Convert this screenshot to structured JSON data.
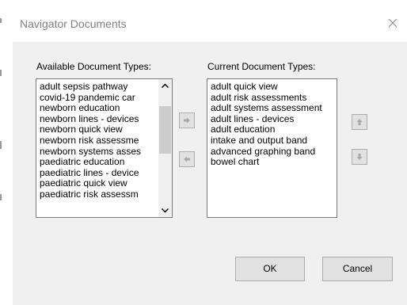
{
  "dialog": {
    "title": "Navigator Documents",
    "close_icon": "close-icon"
  },
  "available": {
    "label": "Available Document Types:",
    "items": [
      "adult sepsis pathway",
      "covid-19 pandemic car",
      "newborn education",
      "newborn lines - devices",
      "newborn quick view",
      "newborn risk assessme",
      "newborn systems asses",
      "paediatric education",
      "paediatric lines - device",
      "paediatric quick view",
      "paediatric risk assessm"
    ]
  },
  "current": {
    "label": "Current Document Types:",
    "items": [
      "adult quick view",
      "adult risk assessments",
      "adult systems assessment",
      "adult lines - devices",
      "adult education",
      "intake and output band",
      "advanced graphing band",
      "bowel chart"
    ]
  },
  "icons": {
    "add": "arrow-right-icon",
    "remove": "arrow-left-icon",
    "move_up": "arrow-up-icon",
    "move_down": "arrow-down-icon",
    "scroll_up": "scroll-up-icon",
    "scroll_down": "scroll-down-icon"
  },
  "buttons": {
    "ok": "OK",
    "cancel": "Cancel"
  }
}
